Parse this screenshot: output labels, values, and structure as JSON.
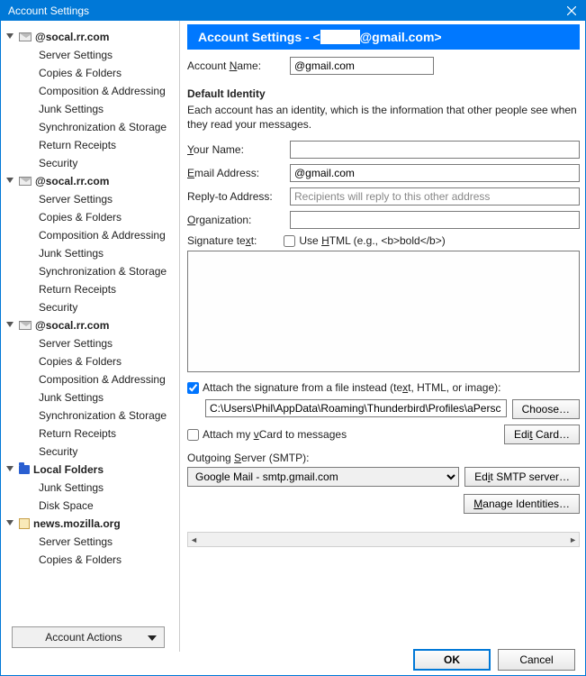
{
  "window": {
    "title": "Account Settings"
  },
  "sidebar": {
    "accounts": [
      {
        "name": "@socal.rr.com",
        "icon": "mail",
        "children": [
          "Server Settings",
          "Copies & Folders",
          "Composition & Addressing",
          "Junk Settings",
          "Synchronization & Storage",
          "Return Receipts",
          "Security"
        ]
      },
      {
        "name": "@socal.rr.com",
        "icon": "mail",
        "children": [
          "Server Settings",
          "Copies & Folders",
          "Composition & Addressing",
          "Junk Settings",
          "Synchronization & Storage",
          "Return Receipts",
          "Security"
        ]
      },
      {
        "name": "@socal.rr.com",
        "icon": "mail",
        "children": [
          "Server Settings",
          "Copies & Folders",
          "Composition & Addressing",
          "Junk Settings",
          "Synchronization & Storage",
          "Return Receipts",
          "Security"
        ]
      },
      {
        "name": "Local Folders",
        "icon": "folder",
        "children": [
          "Junk Settings",
          "Disk Space"
        ]
      },
      {
        "name": "news.mozilla.org",
        "icon": "news",
        "children": [
          "Server Settings",
          "Copies & Folders"
        ]
      }
    ],
    "account_actions": "Account Actions"
  },
  "header": {
    "label": "Account Settings - <",
    "email": "@gmail.com>"
  },
  "account_name": {
    "label": "Account Name:",
    "value": "@gmail.com"
  },
  "identity": {
    "title": "Default Identity",
    "desc": "Each account has an identity, which is the information that other people see when they read your messages.",
    "your_name_label": "Your Name:",
    "your_name_value": "",
    "email_label": "Email Address:",
    "email_value": "@gmail.com",
    "reply_label": "Reply-to Address:",
    "reply_placeholder": "Recipients will reply to this other address",
    "org_label": "Organization:",
    "org_value": "",
    "sig_label": "Signature text:",
    "use_html_label": "Use HTML (e.g., <b>bold</b>)"
  },
  "attach_sig": {
    "label": "Attach the signature from a file instead (text, HTML, or image):",
    "path": "C:\\Users\\Phil\\AppData\\Roaming\\Thunderbird\\Profiles\\aPersc",
    "choose": "Choose…"
  },
  "vcard": {
    "label": "Attach my vCard to messages",
    "edit": "Edit Card…"
  },
  "smtp": {
    "label": "Outgoing Server (SMTP):",
    "value": "Google Mail - smtp.gmail.com",
    "edit": "Edit SMTP server…"
  },
  "manage": "Manage Identities…",
  "buttons": {
    "ok": "OK",
    "cancel": "Cancel"
  }
}
